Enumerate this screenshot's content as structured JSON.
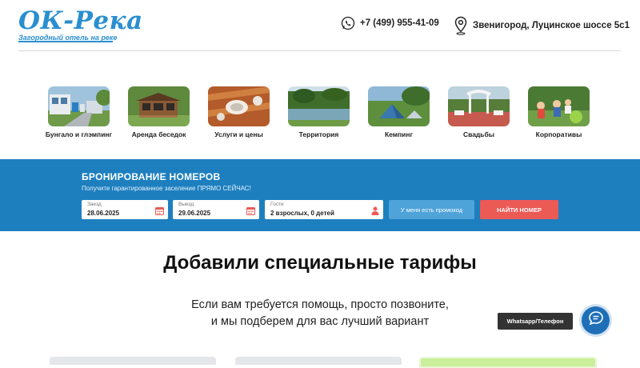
{
  "header": {
    "logo_text": "ОК-Река",
    "logo_subtitle": "Загородный отель на реке",
    "phone": "+7 (499) 955-41-09",
    "address": "Звенигород, Луцинское шоссе 5с1"
  },
  "categories": [
    {
      "label": "Бунгало и глэмпинг"
    },
    {
      "label": "Аренда беседок"
    },
    {
      "label": "Услуги и цены"
    },
    {
      "label": "Территория"
    },
    {
      "label": "Кемпинг"
    },
    {
      "label": "Свадьбы"
    },
    {
      "label": "Корпоративы"
    }
  ],
  "booking": {
    "title": "БРОНИРОВАНИЕ НОМЕРОВ",
    "subtitle": "Получите гарантированное заселение ПРЯМО СЕЙЧАС!",
    "checkin_label": "Заезд",
    "checkin_value": "28.06.2025",
    "checkout_label": "Выезд",
    "checkout_value": "29.06.2025",
    "guests_label": "Гости",
    "guests_value": "2 взрослых, 0 детей",
    "promo_button": "У меня есть промокод",
    "find_button": "НАЙТИ НОМЕР"
  },
  "main": {
    "headline": "Добавили специальные тарифы",
    "help_line1": "Если вам требуется помощь, просто позвоните,",
    "help_line2": "и мы подберем для вас лучший вариант"
  },
  "chat": {
    "label": "Whatsapp/Телефон"
  },
  "colors": {
    "brand_blue": "#2a8fcf",
    "booking_band": "#1e7fbf",
    "find_button": "#ec5a56",
    "promo_button": "#4ea3d9",
    "chat_button": "#1e6fb8"
  }
}
